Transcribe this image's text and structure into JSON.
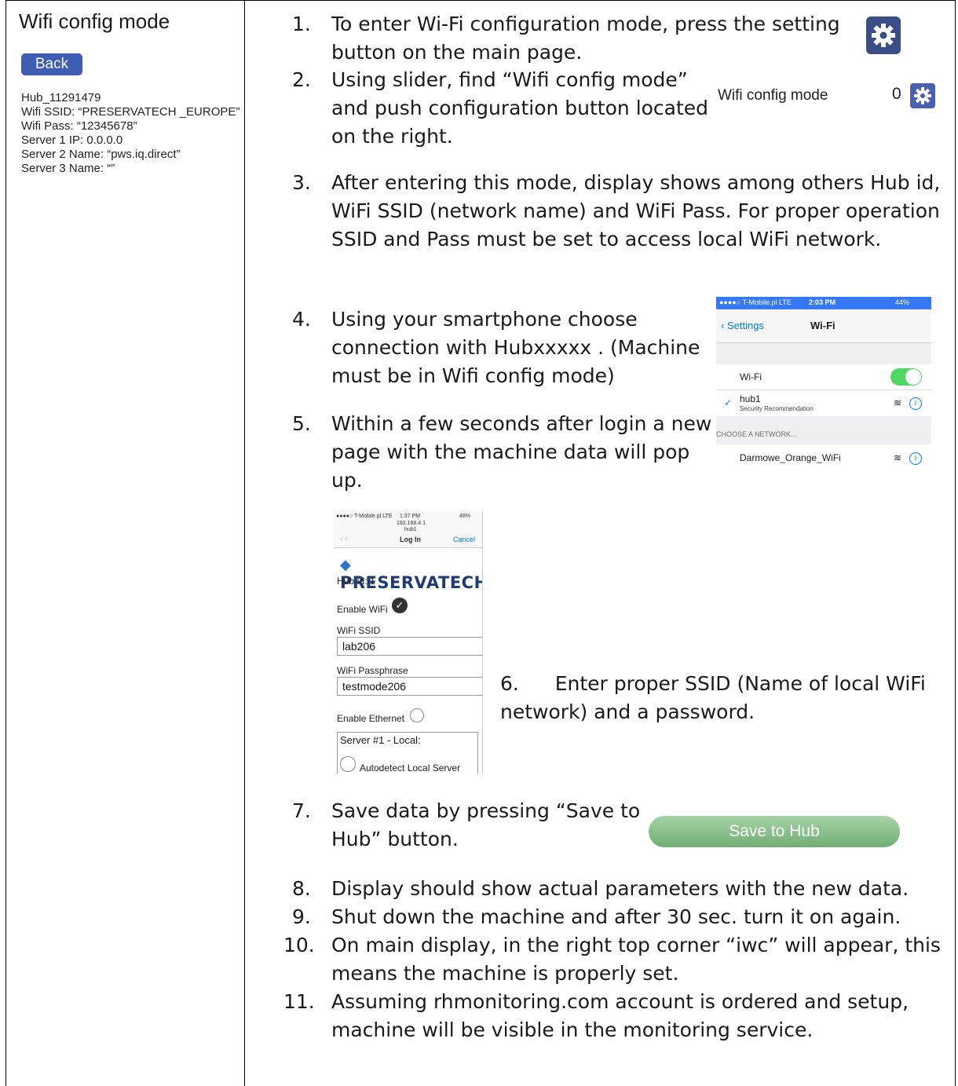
{
  "left": {
    "title": "Wifi config mode",
    "back_label": "Back",
    "info": [
      "Hub_11291479",
      "Wifi SSID: “PRESERVATECH _EUROPE”",
      "Wifi Pass: “12345678”",
      "Server 1 IP: 0.0.0.0",
      "Server 2 Name: “pws.iq.direct”",
      "Server 3 Name: “”"
    ]
  },
  "steps": [
    {
      "n": "1.",
      "lines": [
        "To enter Wi-Fi configuration mode, press the setting",
        "button on the main page."
      ]
    },
    {
      "n": "2.",
      "lines": [
        "Using slider, find “Wifi config mode”",
        "and push configuration button located",
        "on the right."
      ]
    },
    {
      "n": "3.",
      "lines": [
        " After entering this mode, display shows among others Hub id,",
        "WiFi SSID (network name) and WiFi  Pass. For proper operation",
        "SSID and Pass must be set to access local WiFi network."
      ]
    },
    {
      "n": "4.",
      "lines": [
        "Using your smartphone choose",
        "connection with Hubxxxxx . (Machine",
        "must be in Wifi config mode)"
      ]
    },
    {
      "n": "5.",
      "lines": [
        "Within a few seconds after login a new",
        "page with the machine data will pop",
        "up."
      ]
    },
    {
      "n": "6.",
      "lines": [
        "     Enter proper SSID (Name of local WiFi",
        "network) and a password."
      ]
    },
    {
      "n": "7.",
      "lines": [
        "Save data by pressing “Save to",
        "Hub” button."
      ]
    },
    {
      "n": "8.",
      "lines": [
        "Display should show actual parameters with the new data."
      ]
    },
    {
      "n": "9.",
      "lines": [
        "Shut down the machine and after 30 sec. turn it on again."
      ]
    },
    {
      "n": "10.",
      "lines": [
        "On main display, in the right top corner “iwc” will appear, this",
        "means the machine is properly set."
      ]
    },
    {
      "n": "11.",
      "lines": [
        "Assuming rhmonitoring.com account is ordered and setup,",
        "machine will be visible in the monitoring service."
      ]
    }
  ],
  "wifi_config_row": {
    "label": "Wifi config mode",
    "value": "0"
  },
  "ios": {
    "carrier": "●●●●○ T-Mobile.pl  LTE",
    "time": "2:03 PM",
    "battery": "44%",
    "back": "Settings",
    "title": "Wi-Fi",
    "wifi_label": "Wi-Fi",
    "network_name": "hub1",
    "network_sub": "Security Recommendation",
    "section": "CHOOSE A NETWORK...",
    "other_network": "Darmowe_Orange_WiFi"
  },
  "pt": {
    "carrier": "●●●●○ T-Mobile.pl  LTE",
    "time": "1:37 PM",
    "battery": "48%",
    "address": "192.168.4.1",
    "host": "hub1",
    "title": "Log In",
    "cancel": "Cancel",
    "logo": "PRESERVATECH",
    "hub_id": "Hub Id: 1",
    "enable_wifi": "Enable WiFi",
    "ssid_label": "WiFi SSID",
    "ssid_value": "lab206",
    "pass_label": "WiFi Passphrase",
    "pass_value": "testmode206",
    "enable_eth": "Enable Ethernet",
    "server1": "Server #1 - Local:",
    "autodetect": "Autodetect Local Server"
  },
  "save_button": "Save to Hub",
  "colors": {
    "accent": "#3f5db5",
    "ios_blue": "#007aff",
    "toggle": "#4cd964",
    "save": "#8cc38e"
  }
}
